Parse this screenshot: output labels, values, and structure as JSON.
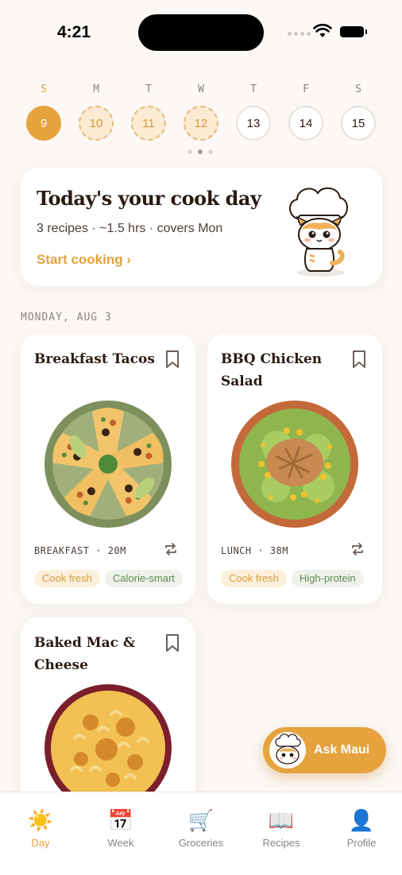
{
  "status": {
    "time": "4:21"
  },
  "week": {
    "days": [
      {
        "letter": "S",
        "date": "9",
        "state": "selected"
      },
      {
        "letter": "M",
        "date": "10",
        "state": "planned"
      },
      {
        "letter": "T",
        "date": "11",
        "state": "planned"
      },
      {
        "letter": "W",
        "date": "12",
        "state": "planned"
      },
      {
        "letter": "T",
        "date": "13",
        "state": "default"
      },
      {
        "letter": "F",
        "date": "14",
        "state": "default"
      },
      {
        "letter": "S",
        "date": "15",
        "state": "default"
      }
    ],
    "page_dots": 3,
    "active_dot": 1
  },
  "hero": {
    "title": "Today's your cook day",
    "subtitle": "3 recipes · ~1.5 hrs · covers Mon",
    "cta": "Start cooking ›"
  },
  "section": {
    "date_label": "MONDAY, AUG 3"
  },
  "recipes": [
    {
      "title": "Breakfast Tacos",
      "meta": "BREAKFAST · 20M",
      "tags": [
        "Cook fresh",
        "Calorie-smart"
      ]
    },
    {
      "title": "BBQ Chicken Salad",
      "meta": "LUNCH · 38M",
      "tags": [
        "Cook fresh",
        "High-protein"
      ]
    },
    {
      "title": "Baked Mac & Cheese",
      "meta": "",
      "tags": []
    }
  ],
  "ask": {
    "label": "Ask Maui"
  },
  "tabs": [
    {
      "label": "Day",
      "icon": "sun-icon",
      "glyph": "☀️",
      "active": true
    },
    {
      "label": "Week",
      "icon": "calendar-icon",
      "glyph": "📅",
      "active": false
    },
    {
      "label": "Groceries",
      "icon": "cart-icon",
      "glyph": "🛒",
      "active": false
    },
    {
      "label": "Recipes",
      "icon": "book-icon",
      "glyph": "📖",
      "active": false
    },
    {
      "label": "Profile",
      "icon": "person-icon",
      "glyph": "👤",
      "active": false
    }
  ],
  "colors": {
    "accent": "#e6a23c",
    "background": "#fbf8f5",
    "text": "#2a1a12"
  }
}
